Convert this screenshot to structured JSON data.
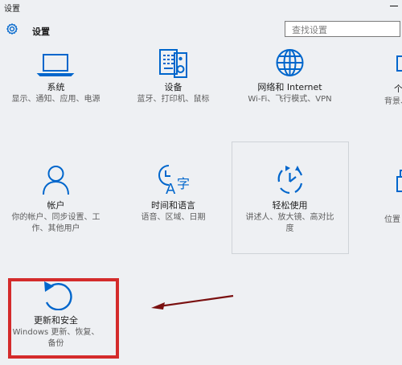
{
  "window": {
    "title": "设置"
  },
  "header": {
    "title": "设置",
    "search_placeholder": "查找设置"
  },
  "tiles": [
    {
      "title": "系统",
      "desc": "显示、通知、应用、电源"
    },
    {
      "title": "设备",
      "desc": "蓝牙、打印机、鼠标"
    },
    {
      "title": "网络和 Internet",
      "desc": "Wi-Fi、飞行模式、VPN"
    },
    {
      "title": "帐户",
      "desc": "你的帐户、同步设置、工作、其他用户"
    },
    {
      "title": "时间和语言",
      "desc": "语音、区域、日期"
    },
    {
      "title": "轻松使用",
      "desc": "讲述人、放大镜、高对比度"
    },
    {
      "title": "更新和安全",
      "desc": "Windows 更新、恢复、备份"
    }
  ],
  "partial_tiles": [
    {
      "title": "个",
      "desc": "背景、"
    },
    {
      "title": "",
      "desc": "位置"
    }
  ],
  "colors": {
    "accent": "#0066cc",
    "highlight": "#d42b2b",
    "arrow": "#7a1010"
  },
  "icons": [
    "gear-icon",
    "laptop-icon",
    "keyboard-speaker-icon",
    "globe-icon",
    "person-icon",
    "clock-language-icon",
    "ease-of-access-icon",
    "refresh-update-icon"
  ]
}
